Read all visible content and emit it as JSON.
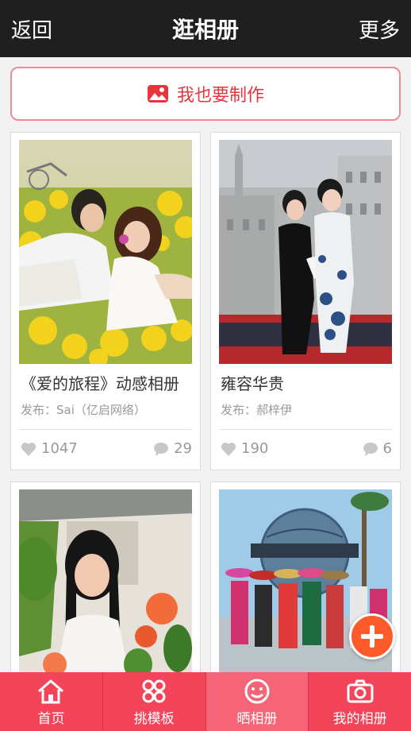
{
  "header": {
    "back_label": "返回",
    "title": "逛相册",
    "more_label": "更多"
  },
  "make_button": {
    "label": "我也要制作",
    "icon": "photo-icon"
  },
  "albums": [
    {
      "title": "《爱的旅程》动感相册",
      "author": "发布：Sai（亿启网络）",
      "likes": "1047",
      "comments": "29"
    },
    {
      "title": "雍容华贵",
      "author": "发布：郝梓伊",
      "likes": "190",
      "comments": "6"
    }
  ],
  "tabbar": {
    "items": [
      {
        "label": "首页",
        "icon": "home-icon"
      },
      {
        "label": "挑模板",
        "icon": "template-icon"
      },
      {
        "label": "晒相册",
        "icon": "face-icon"
      },
      {
        "label": "我的相册",
        "icon": "camera-icon"
      }
    ],
    "active": "晒相册"
  },
  "colors": {
    "accent": "#f3445a",
    "header_bg": "#1f1f1f",
    "fab": "#ff5b2a",
    "make_text": "#e8343f"
  }
}
